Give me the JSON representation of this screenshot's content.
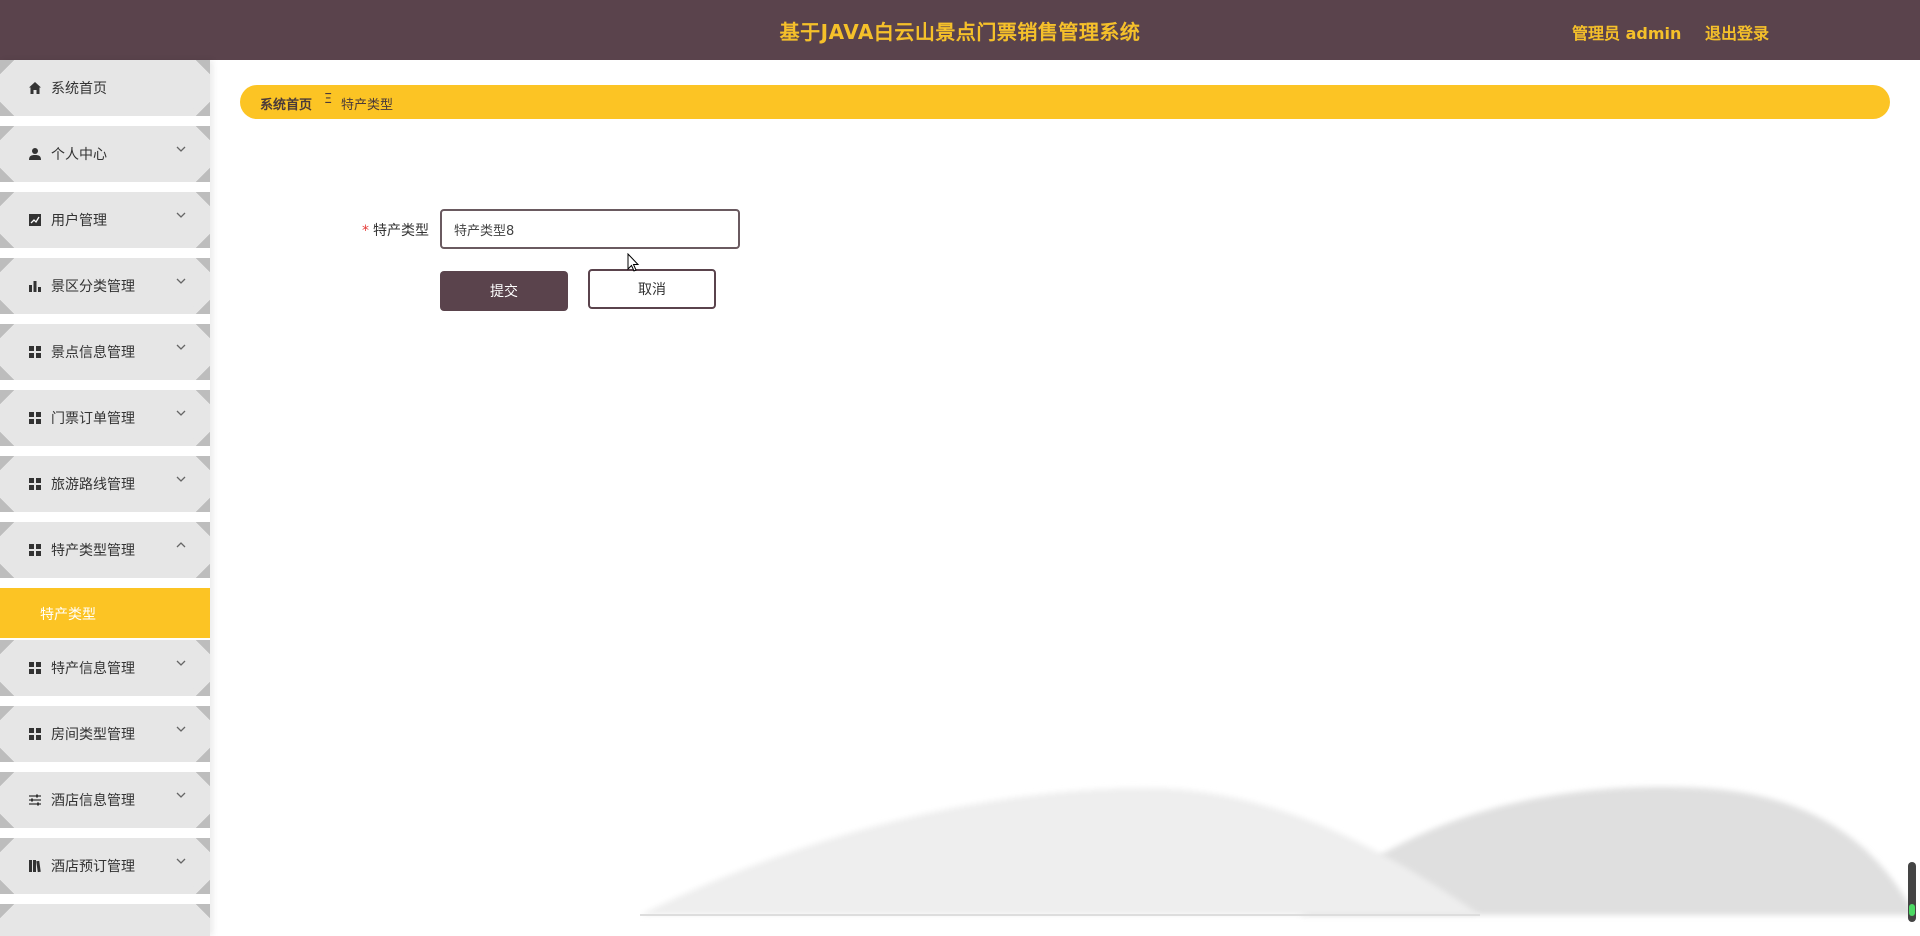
{
  "header": {
    "title": "基于JAVA白云山景点门票销售管理系统",
    "user": "管理员 admin",
    "logout": "退出登录"
  },
  "sidebar": {
    "items": [
      {
        "label": "系统首页",
        "icon": "home-icon",
        "has_arrow": false
      },
      {
        "label": "个人中心",
        "icon": "person-icon",
        "has_arrow": true
      },
      {
        "label": "用户管理",
        "icon": "chart-line-icon",
        "has_arrow": true
      },
      {
        "label": "景区分类管理",
        "icon": "bar-chart-icon",
        "has_arrow": true
      },
      {
        "label": "景点信息管理",
        "icon": "grid-icon",
        "has_arrow": true
      },
      {
        "label": "门票订单管理",
        "icon": "grid-icon",
        "has_arrow": true
      },
      {
        "label": "旅游路线管理",
        "icon": "grid-icon",
        "has_arrow": true
      },
      {
        "label": "特产类型管理",
        "icon": "grid-icon",
        "has_arrow": true,
        "expanded": true
      },
      {
        "label": "特产信息管理",
        "icon": "grid-icon",
        "has_arrow": true
      },
      {
        "label": "房间类型管理",
        "icon": "grid-icon",
        "has_arrow": true
      },
      {
        "label": "酒店信息管理",
        "icon": "sliders-icon",
        "has_arrow": true
      },
      {
        "label": "酒店预订管理",
        "icon": "book-icon",
        "has_arrow": true
      }
    ],
    "active_sub": "特产类型"
  },
  "breadcrumb": {
    "home": "系统首页",
    "separator": "Ξ",
    "current": "特产类型"
  },
  "form": {
    "label": "特产类型",
    "required_mark": "*",
    "value": "特产类型8",
    "submit": "提交",
    "cancel": "取消"
  },
  "colors": {
    "header_bg": "#5a434c",
    "accent": "#fcc424",
    "title_text": "#f5c02a"
  }
}
